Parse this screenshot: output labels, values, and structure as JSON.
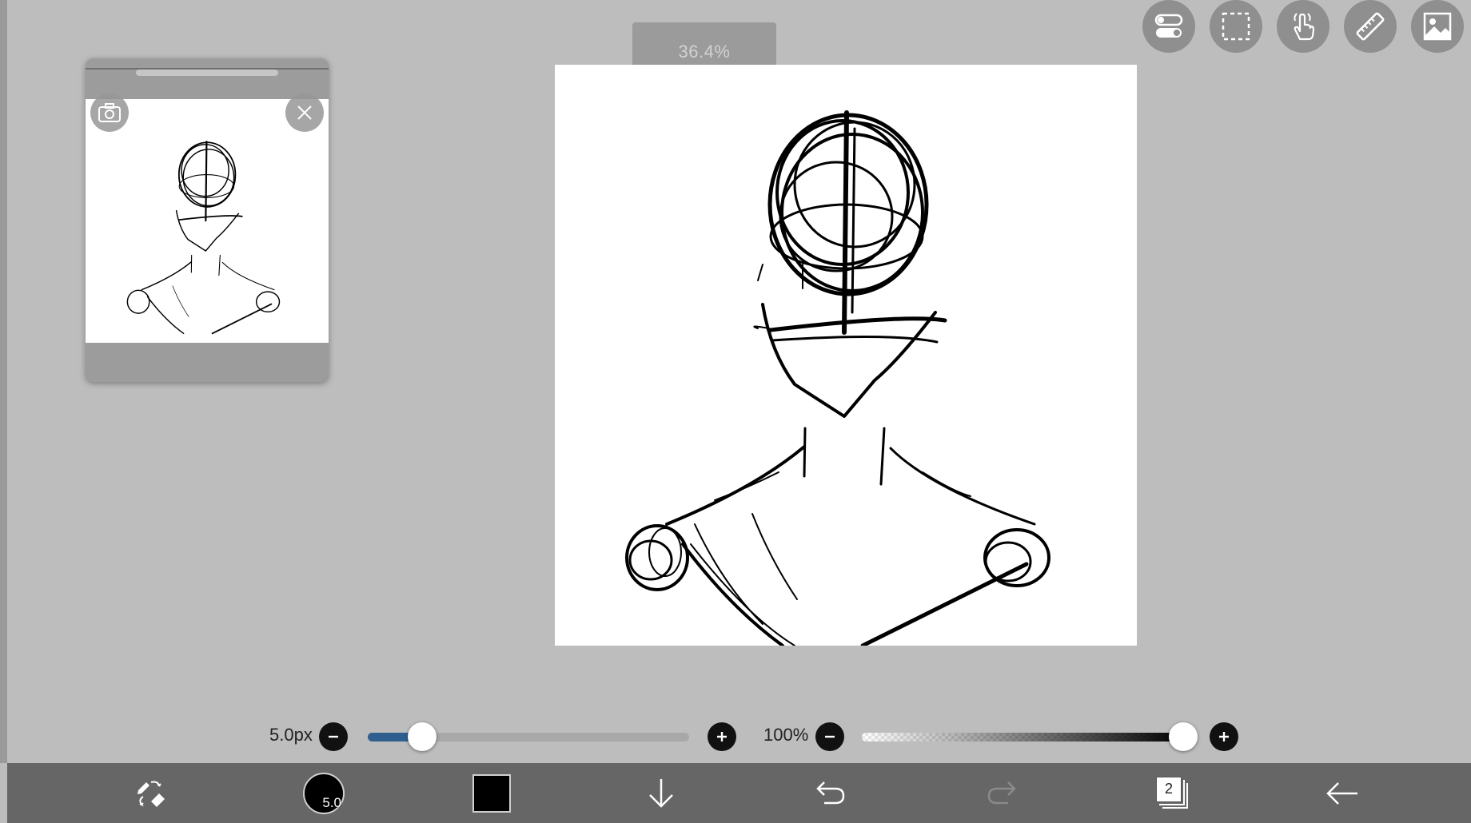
{
  "zoom": {
    "label": "36.4%"
  },
  "top_tools": [
    {
      "name": "toggle-settings-icon"
    },
    {
      "name": "selection-icon"
    },
    {
      "name": "hand-tool-icon"
    },
    {
      "name": "ruler-icon"
    },
    {
      "name": "image-material-icon"
    }
  ],
  "reference_window": {
    "camera_icon": "camera-icon",
    "close_icon": "close-icon"
  },
  "brush_size": {
    "label": "5.0px",
    "value_fraction": 0.17,
    "decrease": "minus-icon",
    "increase": "plus-icon"
  },
  "opacity": {
    "label": "100%",
    "value_fraction": 1.0,
    "decrease": "minus-icon",
    "increase": "plus-icon"
  },
  "bottom_bar": {
    "brush_preview_size": "5.0",
    "current_color": "#000000",
    "layer_count": "2"
  },
  "colors": {
    "accent": "#2f5f8f",
    "toolbar": "#666666",
    "background": "#bdbdbd"
  }
}
